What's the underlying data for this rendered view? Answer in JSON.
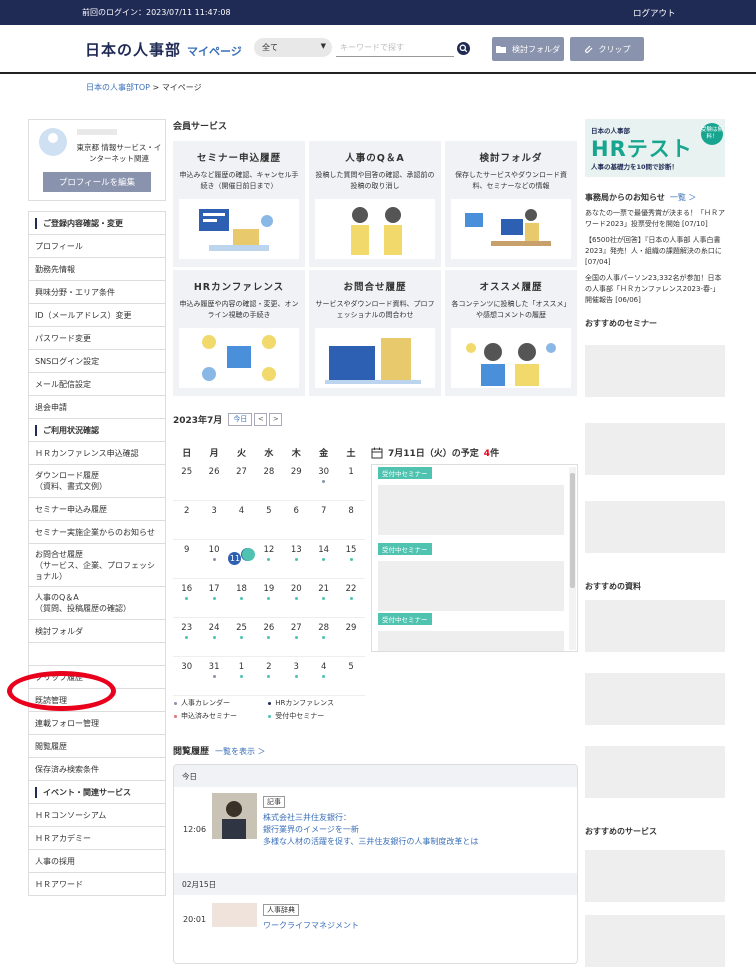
{
  "topbar": {
    "last_login": "前回のログイン：2023/07/11 11:47:08",
    "logout": "ログアウト"
  },
  "header": {
    "logo": "日本の人事部",
    "logo_sub": "マイページ",
    "category": "全て",
    "keyword_placeholder": "キーワードで探す",
    "folder_btn": "検討フォルダ",
    "clip_btn": "クリップ"
  },
  "breadcrumb": {
    "top": "日本の人事部TOP",
    "sep": " > ",
    "current": "マイページ"
  },
  "profile": {
    "org": "東京都 情報サービス・インターネット関連",
    "edit": "プロフィールを編集"
  },
  "menu": {
    "h1": "ご登録内容確認・変更",
    "m1": "プロフィール",
    "m2": "勤務先情報",
    "m3": "興味分野・エリア条件",
    "m4": "ID（メールアドレス）変更",
    "m5": "パスワード変更",
    "m6": "SNSログイン設定",
    "m7": "メール配信設定",
    "m8": "退会申請",
    "h2": "ご利用状況確認",
    "u1": "ＨＲカンファレンス申込確認",
    "u2": "ダウンロード履歴\n（資料、書式文例）",
    "u3": "セミナー申込み履歴",
    "u4": "セミナー実施企業からのお知らせ",
    "u5": "お問合せ履歴\n（サービス、企業、プロフェッショナル）",
    "u6": "人事のQ＆A\n（質問、投稿履歴の確認）",
    "u7": "検討フォルダ",
    "u8": "クリップ履歴",
    "u9": "既読管理",
    "u10": "連載フォロー管理",
    "u11": "閲覧履歴",
    "u12": "保存済み検索条件",
    "h3": "イベント・関連サービス",
    "e1": "ＨＲコンソーシアム",
    "e2": "ＨＲアカデミー",
    "e3": "人事の採用",
    "e4": "ＨＲアワード"
  },
  "services": {
    "title": "会員サービス",
    "cards": [
      {
        "title": "セミナー申込履歴",
        "desc": "申込みなど履歴の確認、キャンセル手続き（開催日前日まで）"
      },
      {
        "title": "人事のQ＆A",
        "desc": "投稿した質問や回答の確認、承認前の投稿の取り消し"
      },
      {
        "title": "検討フォルダ",
        "desc": "保存したサービスやダウンロード資料、セミナーなどの情報"
      },
      {
        "title": "HRカンファレンス",
        "desc": "申込み履歴や内容の確認・変更、オンライン視聴の手続き"
      },
      {
        "title": "お問合せ履歴",
        "desc": "サービスやダウンロード資料、プロフェッショナルの問合わせ"
      },
      {
        "title": "オススメ履歴",
        "desc": "各コンテンツに投稿した「オススメ」や感想コメントの履歴"
      }
    ]
  },
  "calendar": {
    "month": "2023年7月",
    "today": "今日",
    "prev": "<",
    "next": ">",
    "dow": [
      "日",
      "月",
      "火",
      "水",
      "木",
      "金",
      "土"
    ],
    "weeks": [
      [
        "25",
        "26",
        "27",
        "28",
        "29",
        "30",
        "1"
      ],
      [
        "2",
        "3",
        "4",
        "5",
        "6",
        "7",
        "8"
      ],
      [
        "9",
        "10",
        "11",
        "12",
        "13",
        "14",
        "15"
      ],
      [
        "16",
        "17",
        "18",
        "19",
        "20",
        "21",
        "22"
      ],
      [
        "23",
        "24",
        "25",
        "26",
        "27",
        "28",
        "29"
      ],
      [
        "30",
        "31",
        "1",
        "2",
        "3",
        "4",
        "5"
      ]
    ],
    "legend": [
      "人事カレンダー",
      "HRカンファレンス",
      "申込済みセミナー",
      "受付中セミナー"
    ],
    "colors": {
      "hr_calendar": "#8a93ad",
      "conference": "#1f2a55",
      "applied": "#e8736b",
      "open": "#4fc3b0",
      "selected": "#2d5fb3"
    }
  },
  "schedule": {
    "title": "7月11日（火）の予定",
    "count": "4",
    "unit": "件",
    "tag": "受付中セミナー"
  },
  "history": {
    "title": "閲覧履歴",
    "more": "一覧を表示 ＞",
    "groups": [
      {
        "date": "今日",
        "time": "12:06",
        "cat": "記事",
        "title": "株式会社三井住友銀行：\n銀行業界のイメージを一新\n多様な人材の活躍を促す、三井住友銀行の人事制度改革とは"
      },
      {
        "date": "02月15日",
        "time": "20:01",
        "cat": "人事辞典",
        "title": "ワークライフマネジメント"
      }
    ]
  },
  "right": {
    "banner": {
      "line1": "日本の人事部",
      "line2": "HRテスト",
      "line3": "人事の基礎力を10問で診断！",
      "badge": "受験は無料！"
    },
    "news_title": "事務局からのお知らせ",
    "news_more": "一覧 ＞",
    "news": [
      "あなたの一票で最優秀賞が決まる！「ＨＲアワード2023」投票受付を開始 [07/10]",
      "【6500社が回答】『日本の人事部 人事白書2023』発売！人・組織の課題解決の糸口に [07/04]",
      "全国の人事パーソン23,332名が参加！日本の人事部「ＨＲカンファレンス2023-春-」開催報告 [06/06]"
    ],
    "seminar_title": "おすすめのセミナー",
    "docs_title": "おすすめの資料",
    "services_title": "おすすめのサービス"
  }
}
